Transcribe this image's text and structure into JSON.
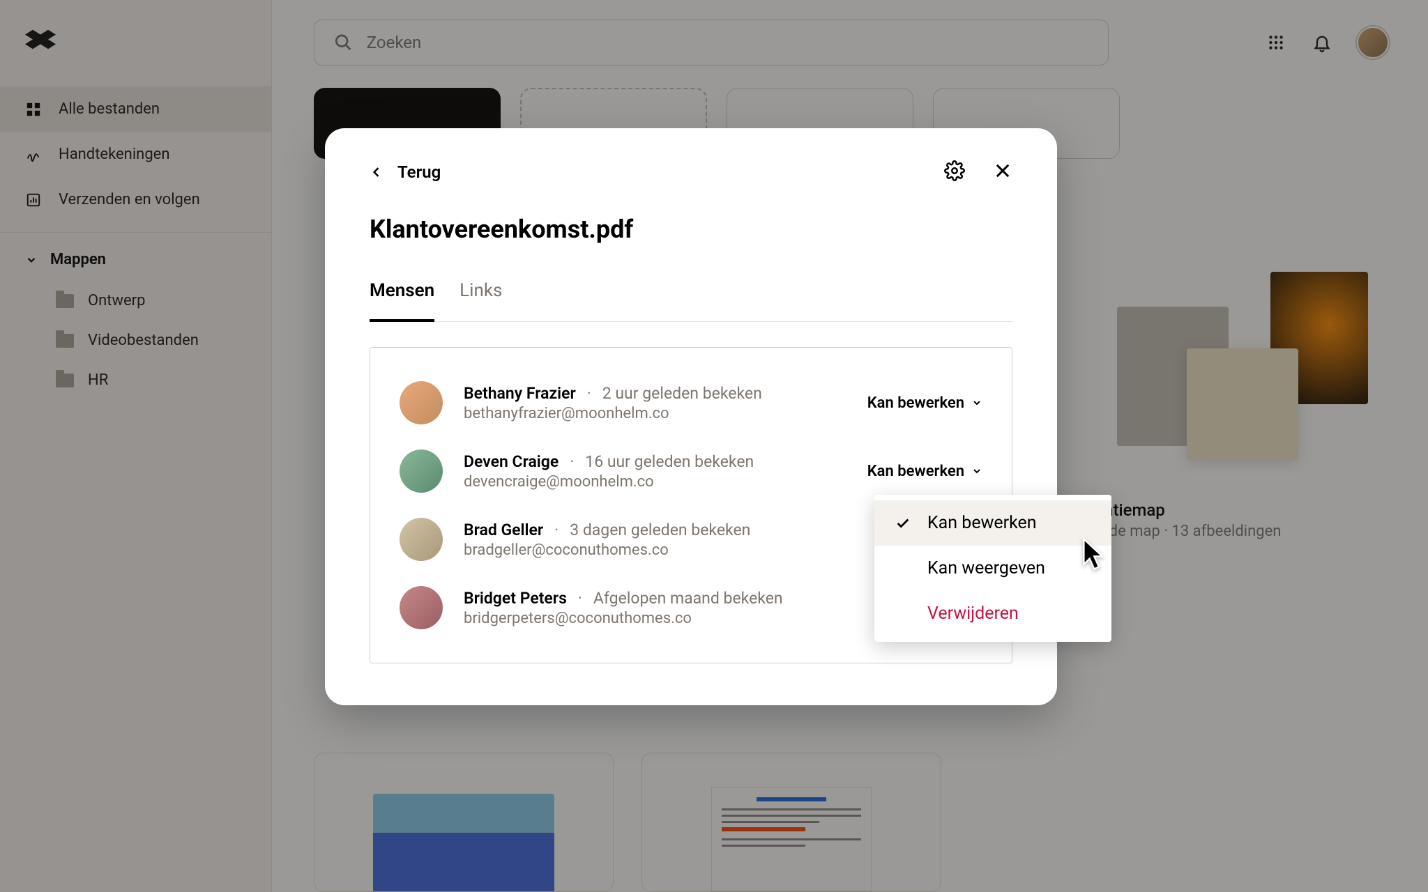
{
  "search": {
    "placeholder": "Zoeken"
  },
  "sidebar": {
    "nav": [
      {
        "label": "Alle bestanden"
      },
      {
        "label": "Handtekeningen"
      },
      {
        "label": "Verzenden en volgen"
      }
    ],
    "folders_header": "Mappen",
    "folders": [
      {
        "label": "Ontwerp"
      },
      {
        "label": "Videobestanden"
      },
      {
        "label": "HR"
      }
    ]
  },
  "card": {
    "title_suffix": "rentiemap",
    "sub_type": "eelde map",
    "sub_count": "13 afbeeldingen"
  },
  "modal": {
    "back": "Terug",
    "title": "Klantovereenkomst.pdf",
    "tabs": {
      "people": "Mensen",
      "links": "Links"
    },
    "perm_label": "Kan bewerken",
    "people": [
      {
        "name": "Bethany Frazier",
        "time": "2 uur geleden bekeken",
        "email": "bethanyfrazier@moonhelm.co"
      },
      {
        "name": "Deven Craige",
        "time": "16 uur geleden bekeken",
        "email": "devencraige@moonhelm.co"
      },
      {
        "name": "Brad Geller",
        "time": "3 dagen geleden bekeken",
        "email": "bradgeller@coconuthomes.co"
      },
      {
        "name": "Bridget Peters",
        "time": "Afgelopen maand bekeken",
        "email": "bridgerpeters@coconuthomes.co"
      }
    ]
  },
  "dropdown": {
    "edit": "Kan bewerken",
    "view": "Kan weergeven",
    "remove": "Verwijderen"
  }
}
